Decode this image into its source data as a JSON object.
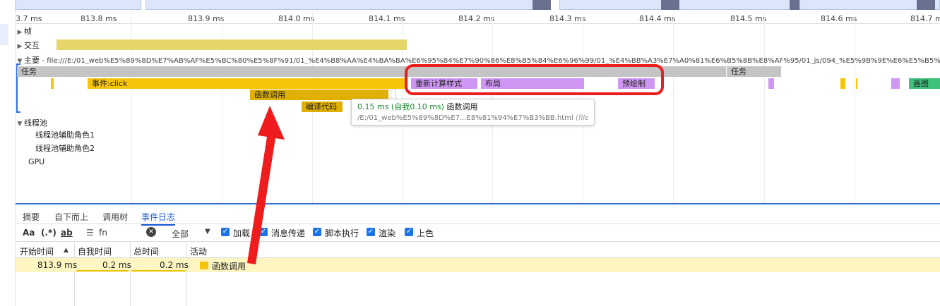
{
  "ruler": {
    "ticks": [
      "3.7 ms",
      "813.8 ms",
      "813.9 ms",
      "814.0 ms",
      "814.1 ms",
      "814.2 ms",
      "814.3 ms",
      "814.4 ms",
      "814.5 ms",
      "814.6 ms",
      "814.7 ms"
    ]
  },
  "tracks": {
    "frames": "帧",
    "interactions": "交互",
    "main_prefix": "主要",
    "main_url": "- file:///E:/01_web%E5%89%8D%E7%AB%AF%E5%BC%80%E5%8F%91/01_%E4%B8%AA%E4%BA%BA%E6%95%B4%E7%90%86%E8%B5%84%E6%96%99/01_%E4%BB%A3%E7%A0%81%E6%B5%8B%E8%AF%95/01_js/094_%E5%9B%9E%E6%E5%B5%81%E8%81%94%E8",
    "task_label": "任务",
    "task_label2": "任务",
    "event_click": "事件:click",
    "recalc_style": "重新计算样式",
    "layout": "布局",
    "prepaint": "预绘制",
    "paint": "画图",
    "function_call": "函数调用",
    "compile_code": "编译代码",
    "thread_pool": "线程池",
    "thread_helper1": "线程池辅助角色1",
    "thread_helper2": "线程池辅助角色2",
    "gpu": "GPU"
  },
  "tooltip": {
    "duration": "0.15 ms (自我0.10 ms)",
    "name": "函数调用",
    "path": "/E:/01_web%E5%89%8D%E7...E8%81%94%E7%B3%BB.html",
    "origin": "(file://)"
  },
  "tabs": [
    "摘要",
    "自下而上",
    "调用树",
    "事件日志"
  ],
  "active_tab": "事件日志",
  "filters": {
    "match_case": "Aa",
    "regex": "(.*)",
    "whole_word": "ab",
    "filter_value": "fn",
    "category_select": "全部",
    "checkboxes": [
      "加载",
      "消息传递",
      "脚本执行",
      "渲染",
      "上色"
    ]
  },
  "table": {
    "headers": [
      "开始时间",
      "自我时间",
      "总时间",
      "活动"
    ],
    "rows": [
      {
        "start": "813.9 ms",
        "self": "0.2 ms",
        "total": "0.2 ms",
        "activity": "函数调用"
      }
    ]
  },
  "colors": {
    "scripting": "#f6c50b",
    "rendering": "#cf96f4",
    "painting": "#3cc27a",
    "annotation": "#ee1c1c",
    "accent": "#1a73e8"
  }
}
